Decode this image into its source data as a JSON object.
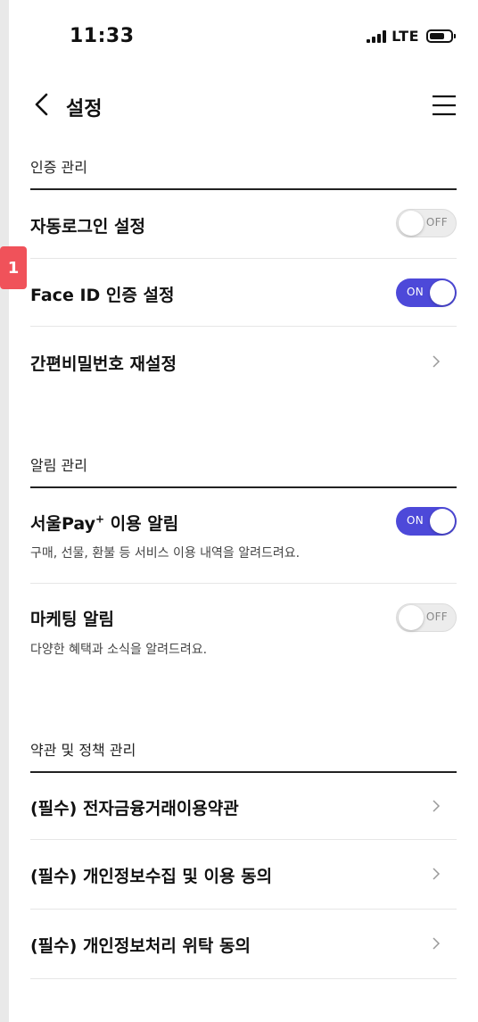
{
  "status_bar": {
    "time": "11:33",
    "network": "LTE",
    "icons": [
      "signal-icon",
      "battery-icon"
    ]
  },
  "annotation_badge": "1",
  "header": {
    "title": "설정",
    "back_icon": "back-chevron-icon",
    "menu_icon": "hamburger-menu-icon"
  },
  "sections": {
    "auth": {
      "title": "인증 관리",
      "auto_login": {
        "label": "자동로그인 설정",
        "toggle": "OFF",
        "on": false
      },
      "face_id": {
        "label": "Face ID 인증 설정",
        "toggle": "ON",
        "on": true
      },
      "simple_pin": {
        "label": "간편비밀번호 재설정",
        "icon": "chevron-right-icon"
      }
    },
    "notifications": {
      "title": "알림 관리",
      "pay_usage": {
        "label_pre": "서울Pay",
        "label_sup": "+",
        "label_post": " 이용 알림",
        "description": "구매, 선물, 환불 등 서비스 이용 내역을 알려드려요.",
        "toggle": "ON",
        "on": true
      },
      "marketing": {
        "label": "마케팅 알림",
        "description": "다양한 혜택과 소식을 알려드려요.",
        "toggle": "OFF",
        "on": false
      }
    },
    "terms": {
      "title": "약관 및 정책 관리",
      "items": [
        {
          "label": "(필수) 전자금융거래이용약관",
          "icon": "chevron-right-icon"
        },
        {
          "label": "(필수) 개인정보수집 및 이용 동의",
          "icon": "chevron-right-icon"
        },
        {
          "label": "(필수) 개인정보처리 위탁 동의",
          "icon": "chevron-right-icon"
        }
      ]
    }
  },
  "colors": {
    "toggle_on": "#4d49d9",
    "toggle_off": "#ececec",
    "badge": "#f0525a"
  }
}
